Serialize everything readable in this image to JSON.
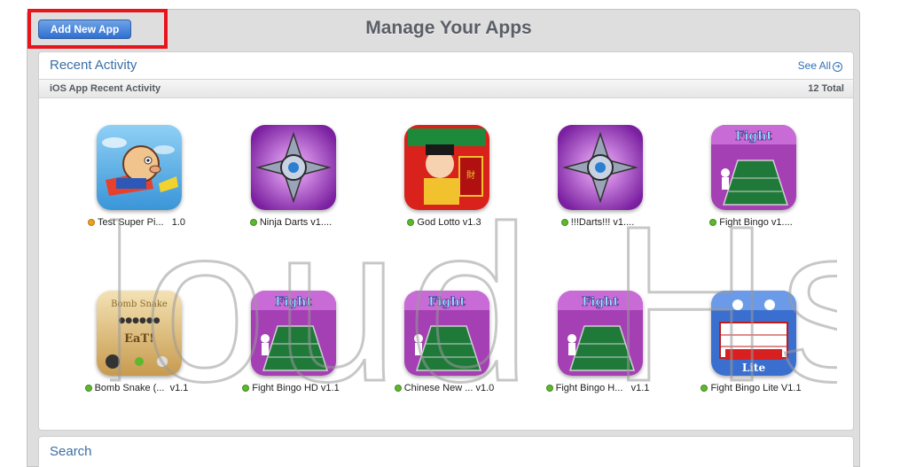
{
  "header": {
    "add_button_label": "Add New App",
    "title": "Manage Your Apps"
  },
  "recent_activity": {
    "title": "Recent Activity",
    "see_all_label": "See All",
    "see_all_icon": "arrow-circle-icon",
    "subheader_label": "iOS App Recent Activity",
    "total_label": "12 Total",
    "apps": [
      {
        "name": "Test Super Pi...",
        "version": "1.0",
        "status": "orange",
        "icon": "cartoon-pig-flying-icon"
      },
      {
        "name": "Ninja Darts v1....",
        "version": "",
        "status": "green",
        "icon": "shuriken-purple-icon"
      },
      {
        "name": "God Lotto v1.3",
        "version": "",
        "status": "green",
        "icon": "god-of-wealth-red-icon"
      },
      {
        "name": "!!!Darts!!! v1....",
        "version": "",
        "status": "green",
        "icon": "shuriken-purple-icon"
      },
      {
        "name": "Fight Bingo v1....",
        "version": "",
        "status": "green",
        "icon": "fight-bingo-icon"
      },
      {
        "name": "Bomb Snake (...",
        "version": "v1.1",
        "status": "green",
        "icon": "bomb-snake-icon"
      },
      {
        "name": "Fight Bingo HD v1.1",
        "version": "",
        "status": "green",
        "icon": "fight-bingo-icon"
      },
      {
        "name": "Chinese New ...",
        "version": "v1.0",
        "status": "green",
        "icon": "fight-bingo-icon"
      },
      {
        "name": "Fight Bingo H...",
        "version": "v1.1",
        "status": "green",
        "icon": "fight-bingo-icon"
      },
      {
        "name": "Fight Bingo Lite V1.1",
        "version": "",
        "status": "green",
        "icon": "fight-bingo-lite-icon"
      }
    ]
  },
  "search": {
    "title": "Search"
  },
  "watermark": {
    "text": "Cloud Hsu"
  },
  "colors": {
    "status_green": "#5cb82e",
    "status_orange": "#f0a020",
    "highlight_red": "#e8141b",
    "link_blue": "#2f6fb7"
  }
}
